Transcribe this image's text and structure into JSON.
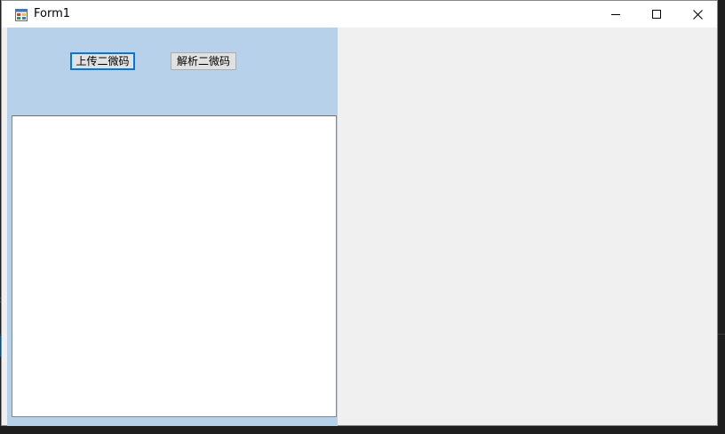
{
  "window": {
    "title": "Form1",
    "icon": "form-app-icon",
    "controls": {
      "minimize_icon": "minimize-icon",
      "maximize_icon": "maximize-icon",
      "close_icon": "close-icon"
    }
  },
  "toolbar": {
    "upload_label": "上传二微码",
    "parse_label": "解析二微码"
  },
  "colors": {
    "panel_bg": "#b8d1ea",
    "form_bg": "#f0f0f0",
    "focus_border": "#0078d7",
    "titlebar_bg": "#ffffff"
  }
}
